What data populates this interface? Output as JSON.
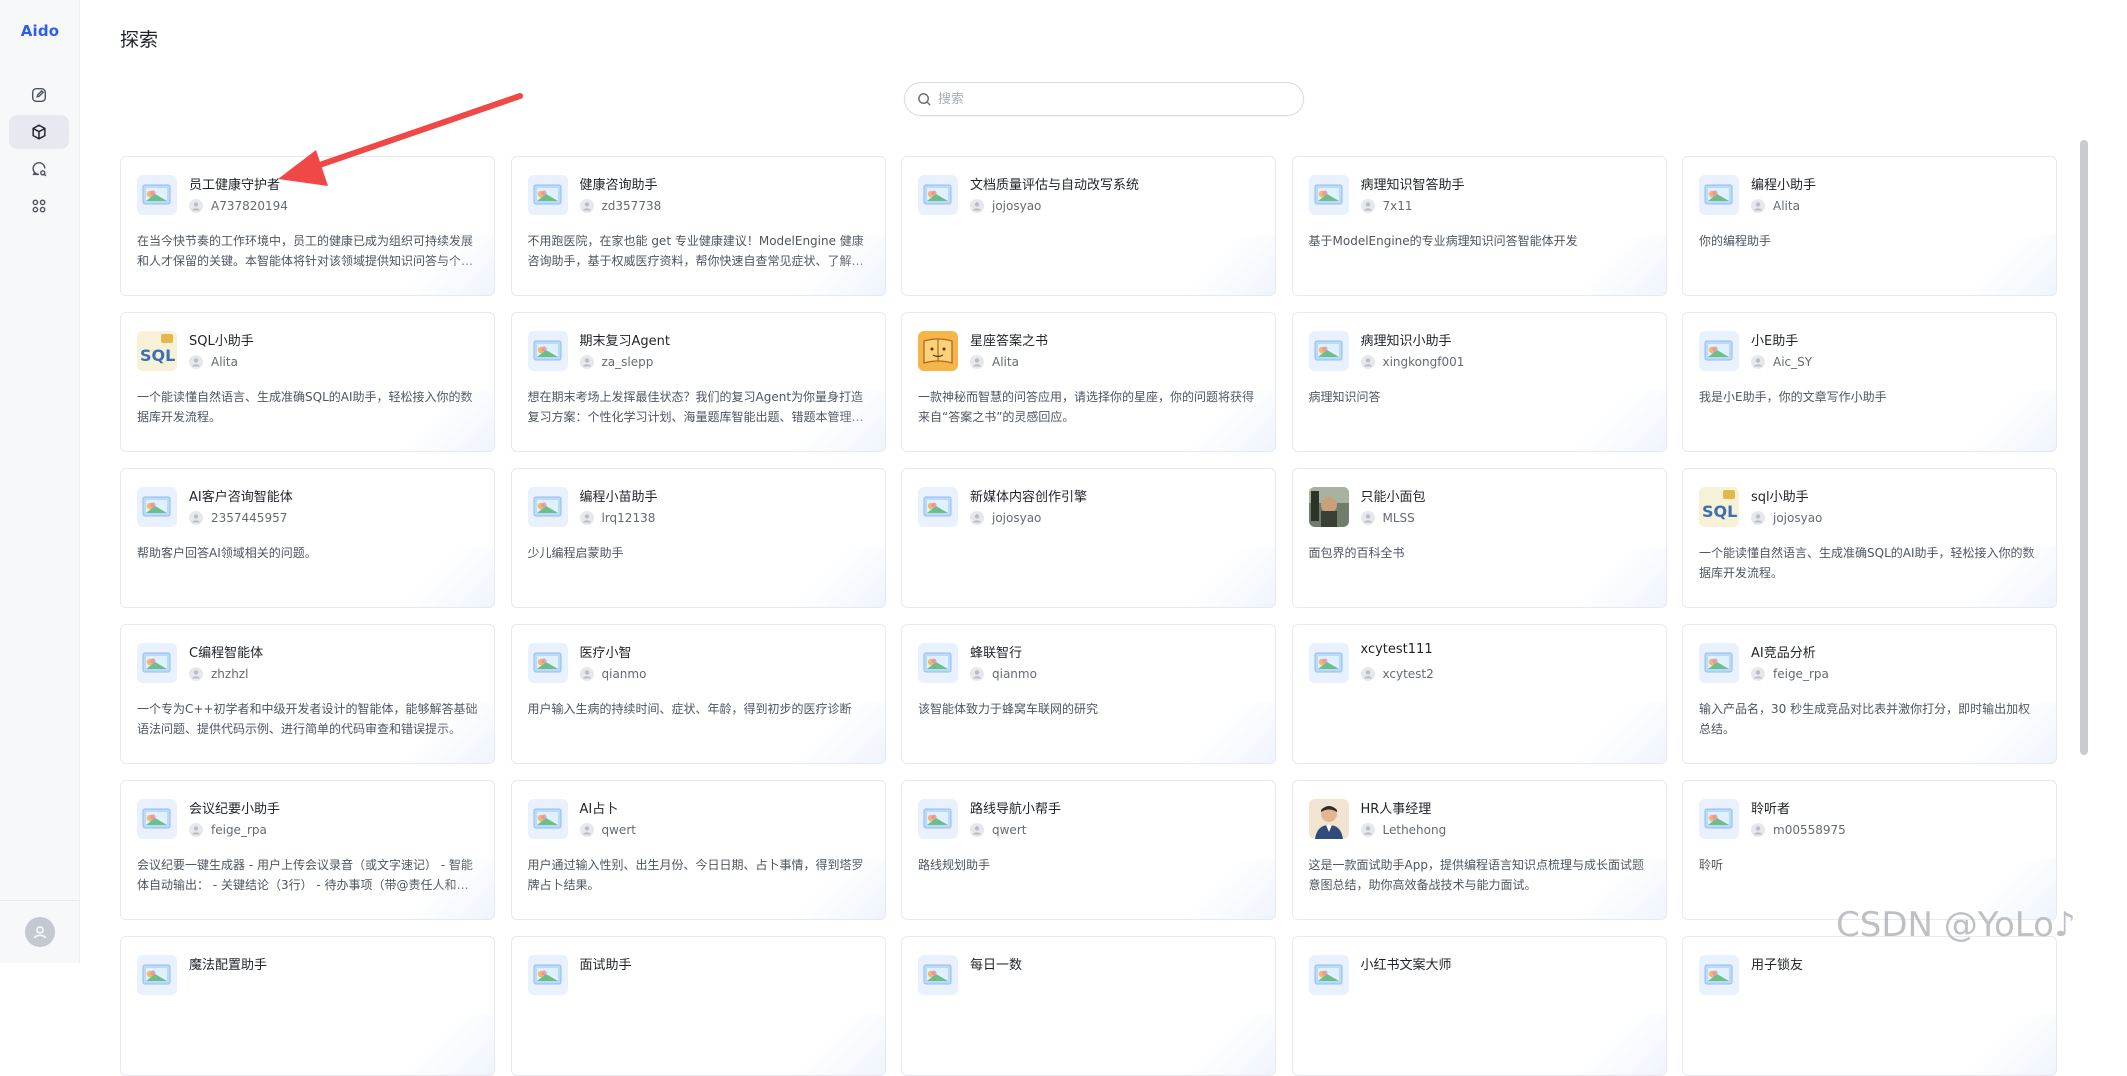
{
  "app": {
    "logo": "Aido",
    "page_title": "探索"
  },
  "sidebar": {
    "items": [
      {
        "name": "edit",
        "icon": "edit-icon",
        "active": false
      },
      {
        "name": "explore",
        "icon": "cube-icon",
        "active": true
      },
      {
        "name": "chat",
        "icon": "chat-search-icon",
        "active": false
      },
      {
        "name": "apps",
        "icon": "apps-grid-icon",
        "active": false
      }
    ],
    "user_icon": "user-avatar-icon"
  },
  "search": {
    "placeholder": "搜索",
    "value": ""
  },
  "cards": [
    {
      "title": "员工健康守护者",
      "author": "A737820194",
      "desc": "在当今快节奏的工作环境中，员工的健康已成为组织可持续发展和人才保留的关键。本智能体将针对该领域提供知识问答与个性化建议。",
      "icon": "default"
    },
    {
      "title": "健康咨询助手",
      "author": "zd357738",
      "desc": "不用跑医院，在家也能 get 专业健康建议！ModelEngine 健康咨询助手，基于权威医疗资料，帮你快速自查常见症状、了解用药常识。",
      "icon": "default"
    },
    {
      "title": "文档质量评估与自动改写系统",
      "author": "jojosyao",
      "desc": "",
      "icon": "default"
    },
    {
      "title": "病理知识智答助手",
      "author": "7x11",
      "desc": "基于ModelEngine的专业病理知识问答智能体开发",
      "icon": "default"
    },
    {
      "title": "编程小助手",
      "author": "Alita",
      "desc": "你的编程助手",
      "icon": "default"
    },
    {
      "title": "SQL小助手",
      "author": "Alita",
      "desc": "一个能读懂自然语言、生成准确SQL的AI助手，轻松接入你的数据库开发流程。",
      "icon": "sql"
    },
    {
      "title": "期末复习Agent",
      "author": "za_slepp",
      "desc": "想在期末考场上发挥最佳状态？我们的复习Agent为你量身打造复习方案：个性化学习计划、海量题库智能出题、错题本管理与薄弱点分析。",
      "icon": "default"
    },
    {
      "title": "星座答案之书",
      "author": "Alita",
      "desc": "一款神秘而智慧的问答应用，请选择你的星座，你的问题将获得来自“答案之书”的灵感回应。",
      "icon": "book"
    },
    {
      "title": "病理知识小助手",
      "author": "xingkongf001",
      "desc": "病理知识问答",
      "icon": "default"
    },
    {
      "title": "小E助手",
      "author": "Aic_SY",
      "desc": "我是小E助手，你的文章写作小助手",
      "icon": "default"
    },
    {
      "title": "AI客户咨询智能体",
      "author": "2357445957",
      "desc": "帮助客户回答AI领域相关的问题。",
      "icon": "default"
    },
    {
      "title": "编程小苗助手",
      "author": "lrq12138",
      "desc": "少儿编程启蒙助手",
      "icon": "default"
    },
    {
      "title": "新媒体内容创作引擎",
      "author": "jojosyao",
      "desc": "",
      "icon": "default"
    },
    {
      "title": "只能小面包",
      "author": "MLSS",
      "desc": "面包界的百科全书",
      "icon": "photo"
    },
    {
      "title": "sql小助手",
      "author": "jojosyao",
      "desc": "一个能读懂自然语言、生成准确SQL的AI助手，轻松接入你的数据库开发流程。",
      "icon": "sql"
    },
    {
      "title": "C编程智能体",
      "author": "zhzhzl",
      "desc": "一个专为C++初学者和中级开发者设计的智能体，能够解答基础语法问题、提供代码示例、进行简单的代码审查和错误提示。",
      "icon": "default"
    },
    {
      "title": "医疗小智",
      "author": "qianmo",
      "desc": "用户输入生病的持续时间、症状、年龄，得到初步的医疗诊断",
      "icon": "default"
    },
    {
      "title": "蜂联智行",
      "author": "qianmo",
      "desc": "该智能体致力于蜂窝车联网的研究",
      "icon": "default"
    },
    {
      "title": "xcytest111",
      "author": "xcytest2",
      "desc": "",
      "icon": "default"
    },
    {
      "title": "AI竞品分析",
      "author": "feige_rpa",
      "desc": "输入产品名，30 秒生成竞品对比表并激你打分，即时输出加权总结。",
      "icon": "default"
    },
    {
      "title": "会议纪要小助手",
      "author": "feige_rpa",
      "desc": "会议纪要一键生成器 - 用户上传会议录音（或文字速记） - 智能体自动输出： - 关键结论（3行） - 待办事项（带@责任人和截止时间）",
      "icon": "default"
    },
    {
      "title": "AI占卜",
      "author": "qwert",
      "desc": "用户通过输入性别、出生月份、今日日期、占卜事情，得到塔罗牌占卜结果。",
      "icon": "default"
    },
    {
      "title": "路线导航小帮手",
      "author": "qwert",
      "desc": "路线规划助手",
      "icon": "default"
    },
    {
      "title": "HR人事经理",
      "author": "Lethehong",
      "desc": "这是一款面试助手App，提供编程语言知识点梳理与成长面试题意图总结，助你高效备战技术与能力面试。",
      "icon": "person"
    },
    {
      "title": "聆听者",
      "author": "m00558975",
      "desc": "聆听",
      "icon": "default"
    },
    {
      "title": "魔法配置助手",
      "author": "",
      "desc": "",
      "icon": "default"
    },
    {
      "title": "面试助手",
      "author": "",
      "desc": "",
      "icon": "default"
    },
    {
      "title": "每日一数",
      "author": "",
      "desc": "",
      "icon": "default"
    },
    {
      "title": "小红书文案大师",
      "author": "",
      "desc": "",
      "icon": "default"
    },
    {
      "title": "用子锁友",
      "author": "",
      "desc": "",
      "icon": "default"
    }
  ],
  "watermark": "CSDN @YoLo♪",
  "colors": {
    "accent": "#2c5cf5",
    "arrow": "#f04747"
  }
}
